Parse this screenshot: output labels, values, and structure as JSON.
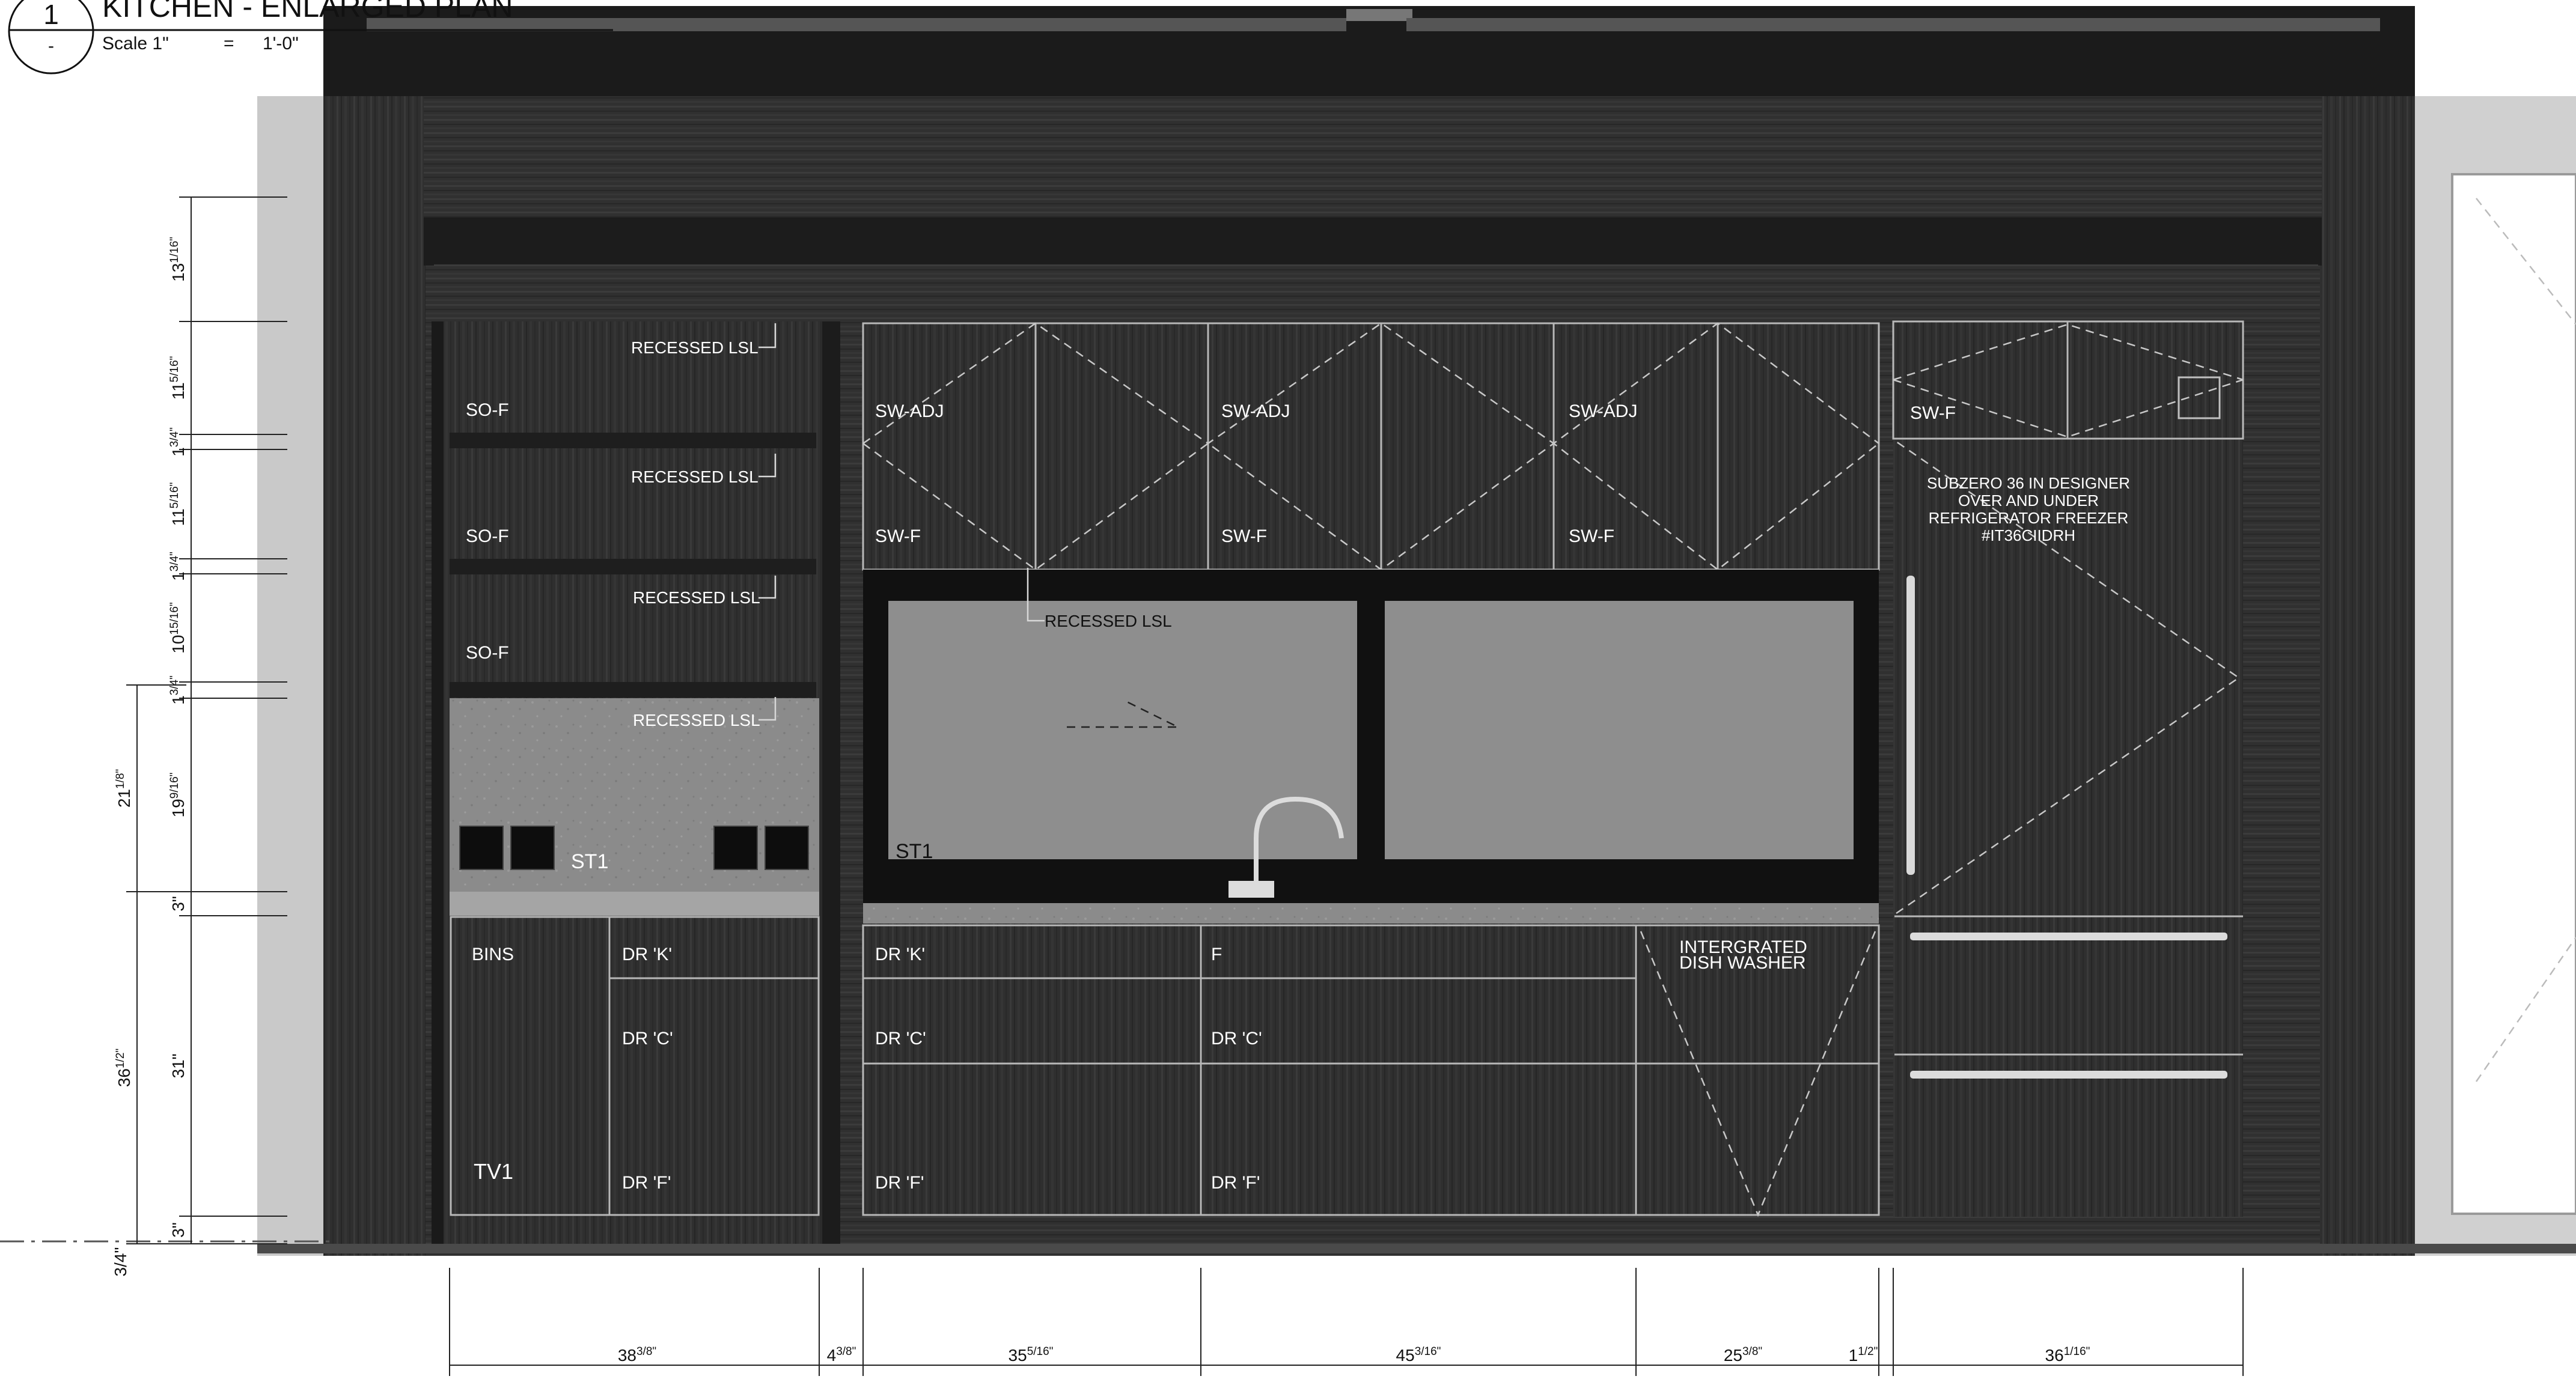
{
  "title": {
    "number": "1",
    "sub": "-",
    "name": "KITCHEN - ENLARGED PLAN",
    "scale_label": "Scale 1\"",
    "scale_eq": "=",
    "scale_value": "1'-0\""
  },
  "tags": {
    "recessed_1": "RECESSED LSL",
    "recessed_2": "RECESSED LSL",
    "recessed_3": "RECESSED LSL",
    "recessed_4": "RECESSED LSL",
    "recessed_5": "RECESSED LSL",
    "so_1": "SO-F",
    "so_2": "SO-F",
    "so_3": "SO-F",
    "swadj_1": "SW-ADJ",
    "swadj_2": "SW-ADJ",
    "swadj_3": "SW-ADJ",
    "swf_1": "SW-F",
    "swf_2": "SW-F",
    "swf_3": "SW-F",
    "swf_4": "SW-F",
    "st1_left": "ST1",
    "st1_sink": "ST1",
    "bins": "BINS",
    "tv1": "TV1",
    "drk_1": "DR 'K'",
    "drk_2": "DR 'K'",
    "drc_1": "DR 'C'",
    "drc_2": "DR 'C'",
    "drc_3": "DR 'C'",
    "drf_1": "DR 'F'",
    "drf_2": "DR 'F'",
    "drf_3": "DR 'F'",
    "f": "F",
    "dishwasher_1": "INTERGRATED",
    "dishwasher_2": "DISH WASHER",
    "fridge_1": "SUBZERO 36 IN DESIGNER",
    "fridge_2": "OVER AND UNDER",
    "fridge_3": "REFRIGERATOR FREEZER",
    "fridge_4": "#IT36CIIDRH"
  },
  "left_dims": [
    {
      "main": "13",
      "frac": "1/16\""
    },
    {
      "main": "11",
      "frac": "5/16\""
    },
    {
      "main": "1",
      "frac": "3/4\""
    },
    {
      "main": "11",
      "frac": "5/16\""
    },
    {
      "main": "1",
      "frac": "3/4\""
    },
    {
      "main": "10",
      "frac": "15/16\""
    },
    {
      "main": "1",
      "frac": "3/4\""
    },
    {
      "main": "19",
      "frac": "9/16\""
    },
    {
      "main": "3\"",
      "frac": ""
    },
    {
      "main": "31\"",
      "frac": ""
    },
    {
      "main": "3\"",
      "frac": ""
    }
  ],
  "outer_dims": [
    {
      "main": "21",
      "frac": "1/8\""
    },
    {
      "main": "36",
      "frac": "1/2\""
    }
  ],
  "bottom_left_dim": {
    "main": "3/4\"",
    "frac": ""
  },
  "bottom_dims": [
    {
      "main": "38",
      "frac": "3/8\""
    },
    {
      "main": "4",
      "frac": "3/8\""
    },
    {
      "main": "35",
      "frac": "5/16\""
    },
    {
      "main": "45",
      "frac": "3/16\""
    },
    {
      "main": "25",
      "frac": "3/8\""
    },
    {
      "main": "1",
      "frac": "1/2\""
    },
    {
      "main": "36",
      "frac": "1/16\""
    }
  ],
  "colors": {
    "cabinet_wood": "#2e2e2e",
    "wall_gray": "#c9c9c9",
    "backsplash_stone": "#8a8a8a",
    "window_glass": "#8e8e8e",
    "line_white": "#e6e6e6"
  }
}
